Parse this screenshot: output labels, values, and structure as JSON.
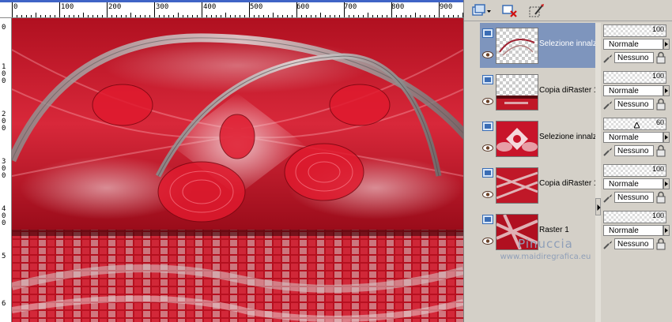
{
  "ruler": {
    "top_labels": [
      "0",
      "100",
      "200",
      "300",
      "400",
      "500",
      "600",
      "700",
      "800",
      "900"
    ],
    "left_labels": [
      "0",
      "1 0 0",
      "2 0 0",
      "3 0 0",
      "4 0 0",
      "5",
      "6"
    ]
  },
  "toolbar": {
    "icons": [
      "new-layer-dropdown-icon",
      "delete-layer-icon",
      "edit-selection-icon"
    ]
  },
  "layers": [
    {
      "name": "Selezione innalza",
      "selected": true
    },
    {
      "name": "Copia diRaster 1",
      "selected": false
    },
    {
      "name": "Selezione innalza",
      "selected": false
    },
    {
      "name": "Copia diRaster 1",
      "selected": false
    },
    {
      "name": "Raster 1",
      "selected": false
    }
  ],
  "properties": [
    {
      "opacity": "100",
      "opacity_fraction": 1.0,
      "blend": "Normale",
      "mask": "Nessuno"
    },
    {
      "opacity": "100",
      "opacity_fraction": 1.0,
      "blend": "Normale",
      "mask": "Nessuno"
    },
    {
      "opacity": "60",
      "opacity_fraction": 0.6,
      "blend": "Normale",
      "mask": "Nessuno"
    },
    {
      "opacity": "100",
      "opacity_fraction": 1.0,
      "blend": "Normale",
      "mask": "Nessuno"
    },
    {
      "opacity": "100",
      "opacity_fraction": 1.0,
      "blend": "Normale",
      "mask": "Nessuno"
    }
  ],
  "watermark": {
    "title": "Pinuccia",
    "site": "www.maidiregrafica.eu"
  },
  "colors": {
    "selection": "#7e95bd",
    "accent_red": "#c8142a",
    "panel": "#d4d0c8"
  }
}
